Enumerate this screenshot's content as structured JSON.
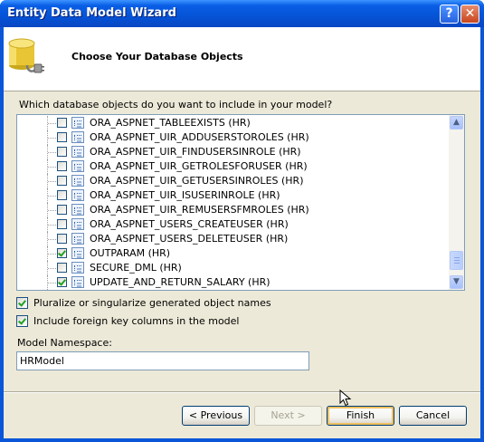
{
  "window": {
    "title": "Entity Data Model Wizard",
    "help_glyph": "?",
    "close_glyph": "✕"
  },
  "header": {
    "title": "Choose Your Database Objects",
    "icon": "database-connector-icon"
  },
  "question": "Which database objects do you want to include in your model?",
  "objects": [
    {
      "label": "ORA_ASPNET_TABLEEXISTS (HR)",
      "checked": false
    },
    {
      "label": "ORA_ASPNET_UIR_ADDUSERSTOROLES (HR)",
      "checked": false
    },
    {
      "label": "ORA_ASPNET_UIR_FINDUSERSINROLE (HR)",
      "checked": false
    },
    {
      "label": "ORA_ASPNET_UIR_GETROLESFORUSER (HR)",
      "checked": false
    },
    {
      "label": "ORA_ASPNET_UIR_GETUSERSINROLES (HR)",
      "checked": false
    },
    {
      "label": "ORA_ASPNET_UIR_ISUSERINROLE (HR)",
      "checked": false
    },
    {
      "label": "ORA_ASPNET_UIR_REMUSERSFMROLES (HR)",
      "checked": false
    },
    {
      "label": "ORA_ASPNET_USERS_CREATEUSER (HR)",
      "checked": false
    },
    {
      "label": "ORA_ASPNET_USERS_DELETEUSER (HR)",
      "checked": false
    },
    {
      "label": "OUTPARAM (HR)",
      "checked": true
    },
    {
      "label": "SECURE_DML (HR)",
      "checked": false
    },
    {
      "label": "UPDATE_AND_RETURN_SALARY (HR)",
      "checked": true
    }
  ],
  "options": {
    "pluralize": {
      "label": "Pluralize or singularize generated object names",
      "checked": true
    },
    "foreign_keys": {
      "label": "Include foreign key columns in the model",
      "checked": true
    }
  },
  "namespace": {
    "label": "Model Namespace:",
    "value": "HRModel"
  },
  "buttons": {
    "previous": "< Previous",
    "next": "Next >",
    "finish": "Finish",
    "cancel": "Cancel"
  },
  "colors": {
    "title_bar": "#0553d6",
    "dialog_bg": "#ece9d8",
    "check": "#21a121"
  }
}
